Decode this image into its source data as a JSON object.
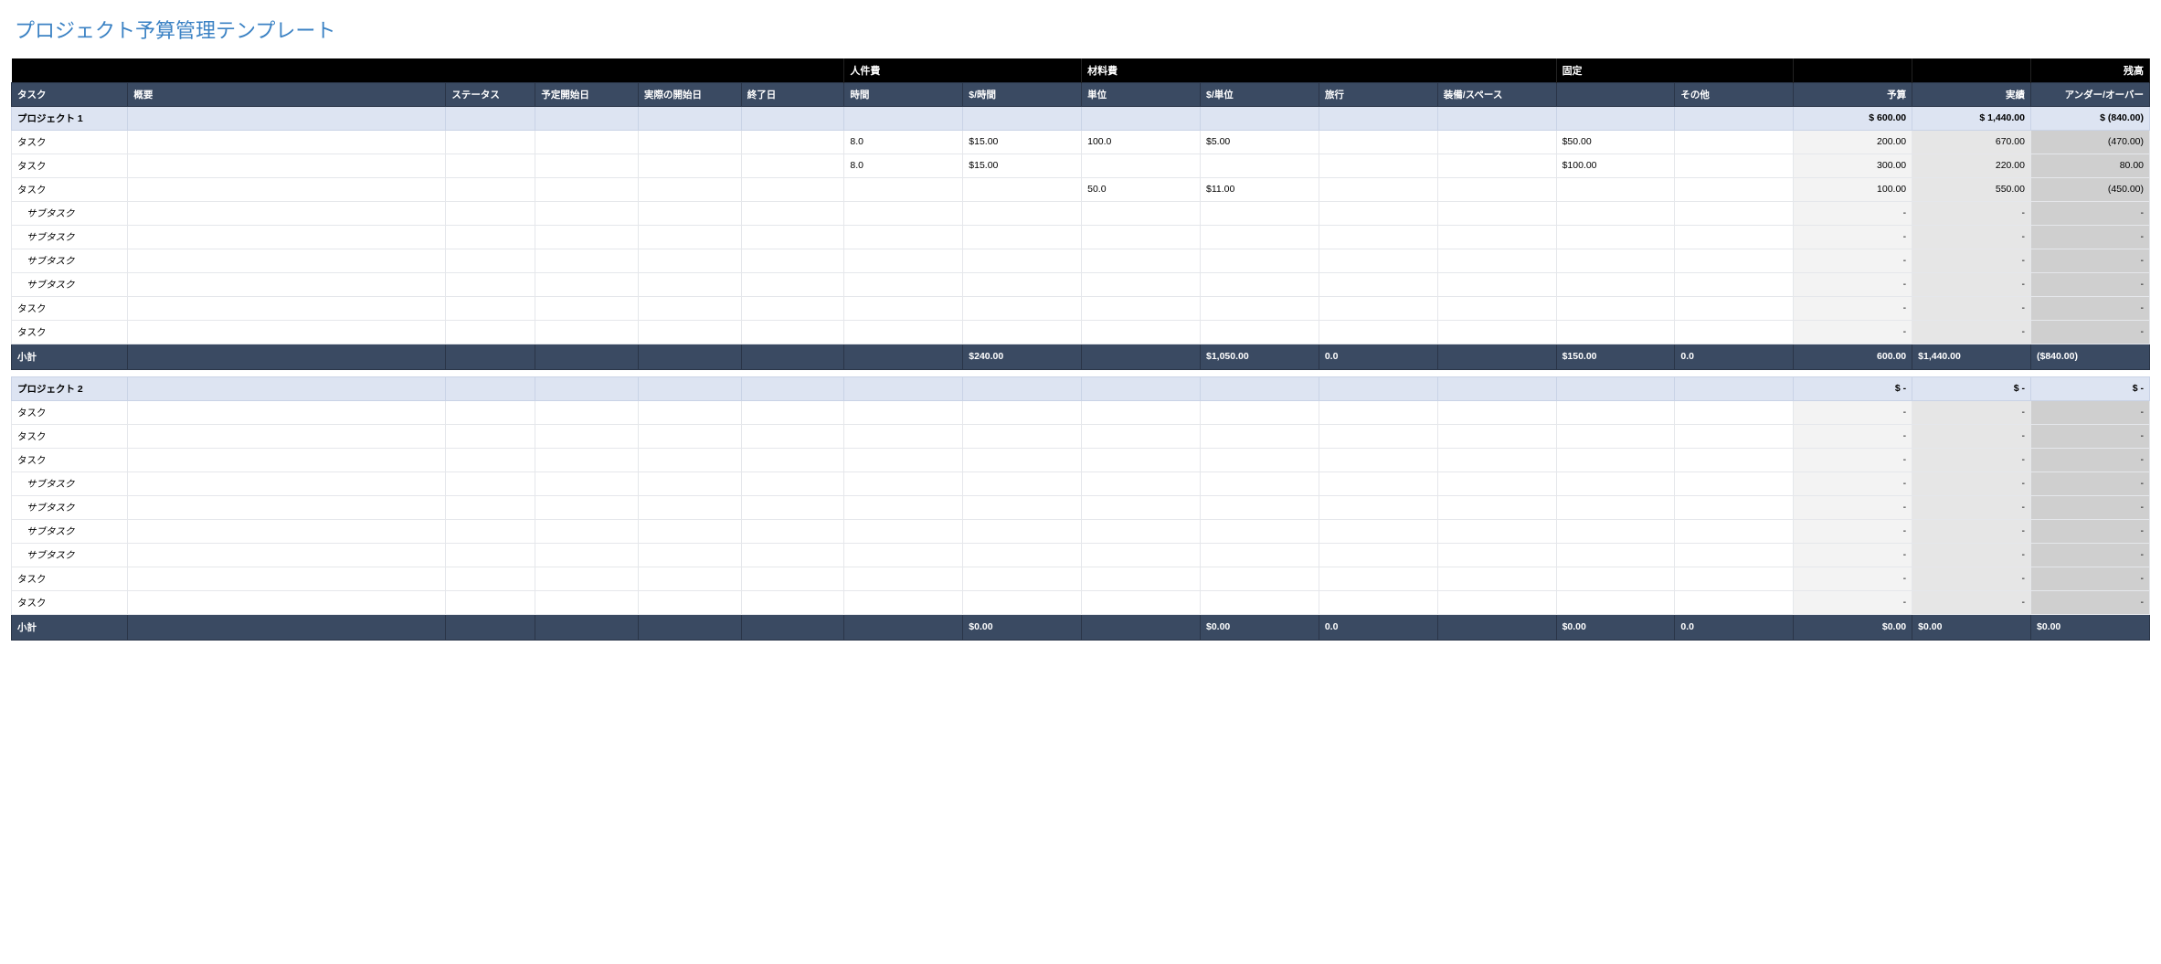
{
  "title": "プロジェクト予算管理テンプレート",
  "topband": {
    "labor": "人件費",
    "materials": "材料費",
    "fixed": "固定",
    "balance": "残高"
  },
  "headers": {
    "task": "タスク",
    "summary": "概要",
    "status": "ステータス",
    "planned_start": "予定開始日",
    "actual_start": "実際の開始日",
    "end": "終了日",
    "hours": "時間",
    "per_hour": "$/時間",
    "units": "単位",
    "per_unit": "$/単位",
    "travel": "旅行",
    "equip": "装備/スペース",
    "fixed_blank": "",
    "other": "その他",
    "budget": "予算",
    "actual": "実績",
    "under_over": "アンダー/オーバー"
  },
  "labels": {
    "subtotal": "小計",
    "task": "タスク",
    "subtask": "サブタスク"
  },
  "projects": [
    {
      "name": "プロジェクト 1",
      "header_budget": "$            600.00",
      "header_actual": "$         1,440.00",
      "header_balance": "$            (840.00)",
      "rows": [
        {
          "type": "task",
          "hours": "8.0",
          "per_hour": "$15.00",
          "units": "100.0",
          "per_unit": "$5.00",
          "travel": "",
          "equip": "",
          "fixed": "$50.00",
          "other": "",
          "budget": "200.00",
          "actual": "670.00",
          "balance": "(470.00)"
        },
        {
          "type": "task",
          "hours": "8.0",
          "per_hour": "$15.00",
          "units": "",
          "per_unit": "",
          "travel": "",
          "equip": "",
          "fixed": "$100.00",
          "other": "",
          "budget": "300.00",
          "actual": "220.00",
          "balance": "80.00"
        },
        {
          "type": "task",
          "hours": "",
          "per_hour": "",
          "units": "50.0",
          "per_unit": "$11.00",
          "travel": "",
          "equip": "",
          "fixed": "",
          "other": "",
          "budget": "100.00",
          "actual": "550.00",
          "balance": "(450.00)"
        },
        {
          "type": "subtask",
          "budget": "-",
          "actual": "-",
          "balance": "-"
        },
        {
          "type": "subtask",
          "budget": "-",
          "actual": "-",
          "balance": "-"
        },
        {
          "type": "subtask",
          "budget": "-",
          "actual": "-",
          "balance": "-"
        },
        {
          "type": "subtask",
          "budget": "-",
          "actual": "-",
          "balance": "-"
        },
        {
          "type": "task",
          "budget": "-",
          "actual": "-",
          "balance": "-"
        },
        {
          "type": "task",
          "budget": "-",
          "actual": "-",
          "balance": "-"
        }
      ],
      "subtotal": {
        "per_hour": "$240.00",
        "per_unit": "$1,050.00",
        "travel": "0.0",
        "fixed": "$150.00",
        "other": "0.0",
        "budget": "600.00",
        "actual": "$1,440.00",
        "balance": "($840.00)"
      }
    },
    {
      "name": "プロジェクト 2",
      "header_budget": "$                   -",
      "header_actual": "$                   -",
      "header_balance": "$                   -",
      "rows": [
        {
          "type": "task",
          "budget": "-",
          "actual": "-",
          "balance": "-"
        },
        {
          "type": "task",
          "budget": "-",
          "actual": "-",
          "balance": "-"
        },
        {
          "type": "task",
          "budget": "-",
          "actual": "-",
          "balance": "-"
        },
        {
          "type": "subtask",
          "budget": "-",
          "actual": "-",
          "balance": "-"
        },
        {
          "type": "subtask",
          "budget": "-",
          "actual": "-",
          "balance": "-"
        },
        {
          "type": "subtask",
          "budget": "-",
          "actual": "-",
          "balance": "-"
        },
        {
          "type": "subtask",
          "budget": "-",
          "actual": "-",
          "balance": "-"
        },
        {
          "type": "task",
          "budget": "-",
          "actual": "-",
          "balance": "-"
        },
        {
          "type": "task",
          "budget": "-",
          "actual": "-",
          "balance": "-"
        }
      ],
      "subtotal": {
        "per_hour": "$0.00",
        "per_unit": "$0.00",
        "travel": "0.0",
        "fixed": "$0.00",
        "other": "0.0",
        "budget": "$0.00",
        "actual": "$0.00",
        "balance": "$0.00"
      }
    }
  ]
}
